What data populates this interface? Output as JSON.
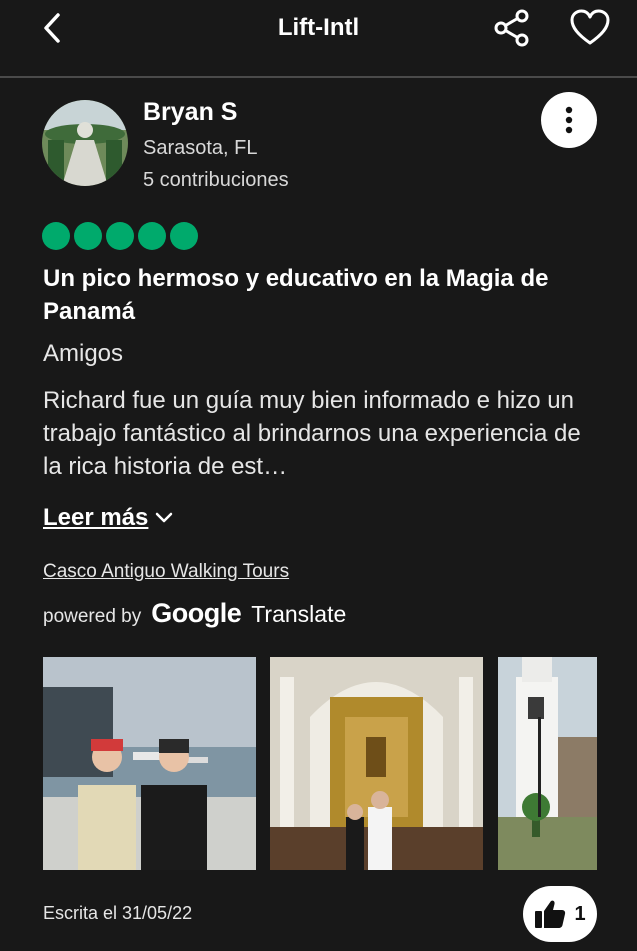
{
  "header": {
    "title": "Lift-Intl",
    "back_icon": "chevron-left-icon",
    "share_icon": "share-icon",
    "save_icon": "heart-icon"
  },
  "reviewer": {
    "name": "Bryan S",
    "location": "Sarasota, FL",
    "contributions": "5 contribuciones"
  },
  "review": {
    "rating": 5,
    "rating_max": 5,
    "rating_color": "#00aa6c",
    "title": "Un pico hermoso y educativo en la Magia de Panamá",
    "trip_type": "Amigos",
    "text": "Richard fue un guía muy bien informado e hizo un trabajo fantástico al brindarnos una experiencia de la rica historia de est…",
    "read_more": "Leer más",
    "tour_link": "Casco Antiguo Walking Tours",
    "powered_by": "powered by",
    "google": "Google",
    "translate": "Translate",
    "written_date": "Escrita el 31/05/22",
    "helpful_count": "1"
  },
  "photos": [
    "kids-at-harbor-photo",
    "cathedral-altar-photo",
    "bell-tower-photo"
  ]
}
